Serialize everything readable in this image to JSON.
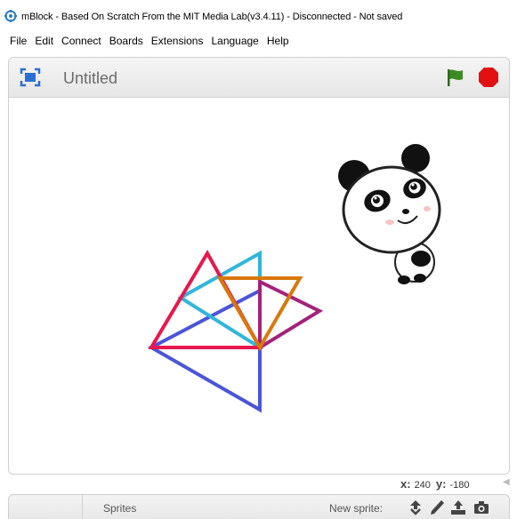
{
  "window": {
    "title": "mBlock - Based On Scratch From the MIT Media Lab(v3.4.11) - Disconnected - Not saved"
  },
  "menu": {
    "items": [
      {
        "label": "File"
      },
      {
        "label": "Edit"
      },
      {
        "label": "Connect"
      },
      {
        "label": "Boards"
      },
      {
        "label": "Extensions"
      },
      {
        "label": "Language"
      },
      {
        "label": "Help"
      }
    ]
  },
  "stage": {
    "project_title": "Untitled",
    "stage_mode_icon": "stage-mode-icon",
    "green_flag_icon": "green-flag-icon",
    "stop_icon": "stop-icon",
    "drawing": {
      "shapes": [
        "red-triangle",
        "cyan-triangle",
        "orange-triangle",
        "purple-triangle",
        "blue-triangle"
      ],
      "colors": {
        "red": "#e8174d",
        "cyan": "#31b6da",
        "orange": "#d9780b",
        "purple": "#a3237a",
        "blue": "#4b55d8"
      }
    },
    "sprite": "panda"
  },
  "coords": {
    "x_label": "x:",
    "x_value": "240",
    "y_label": "y:",
    "y_value": "-180"
  },
  "sprite_bar": {
    "sprites_label": "Sprites",
    "new_sprite_label": "New sprite:",
    "icons": [
      "choose-sprite-icon",
      "paint-sprite-icon",
      "upload-sprite-icon",
      "camera-sprite-icon"
    ]
  }
}
